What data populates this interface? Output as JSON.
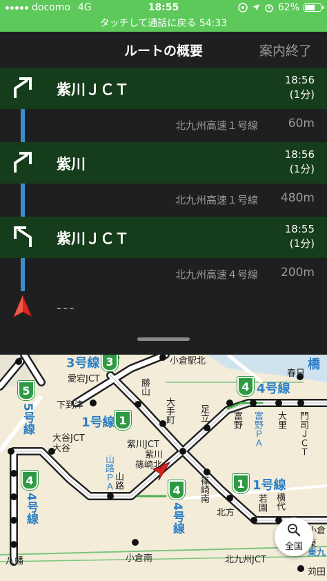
{
  "status_bar": {
    "carrier": "docomo",
    "network": "4G",
    "time": "18:55",
    "battery": "62%",
    "battery_level": 0.62
  },
  "call_banner": {
    "text": "タッチして通話に戻る 54:33"
  },
  "header": {
    "title": "ルートの概要",
    "end_button": "案内終了"
  },
  "steps": [
    {
      "kind": "turn",
      "icon": "turn-right-icon",
      "name": "紫川ＪＣＴ",
      "time": "18:56",
      "duration": "(1分)"
    },
    {
      "kind": "segment",
      "road": "北九州高速１号線",
      "distance": "60m"
    },
    {
      "kind": "turn",
      "icon": "turn-right-icon",
      "name": "紫川",
      "time": "18:56",
      "duration": "(1分)"
    },
    {
      "kind": "segment",
      "road": "北九州高速１号線",
      "distance": "480m"
    },
    {
      "kind": "turn",
      "icon": "turn-left-icon",
      "name": "紫川ＪＣＴ",
      "time": "18:55",
      "duration": "(1分)"
    },
    {
      "kind": "segment",
      "road": "北九州高速４号線",
      "distance": "200m"
    }
  ],
  "destination": {
    "icon": "current-position-arrow-icon",
    "label": "---"
  },
  "map": {
    "labels": {
      "route3": "3号線",
      "num3": "3",
      "kokura_eki_kita": "小倉駅北",
      "route_bashi": "橋",
      "atago_jct": "愛宕JCT",
      "katsuyama": "勝山",
      "kasuga": "春日",
      "num5": "5",
      "route5": "5号線",
      "shimoitozu": "下到津",
      "route1": "1号線",
      "num1": "1",
      "ohtemachi": "大手町",
      "ashidachi": "足立",
      "num4a": "4",
      "route4a": "4号線",
      "tomino": "富野",
      "tomino_pa": "富野ＰＡ",
      "ozato": "大里",
      "monji_jct": "門司ＪＣＴ",
      "otani_jct": "大谷JCT",
      "otani": "大谷",
      "murasaki_jct": "紫川JCT",
      "murasaki": "紫川",
      "shinozaki_kita": "篠崎北",
      "yamaji_pa": "山路ＰＡ",
      "yamaji": "山路",
      "num4b": "4",
      "route4b": "4号線",
      "num4c": "4",
      "route4c": "4号線",
      "shinozaki_minami": "篠崎南",
      "num1b": "1",
      "route1b": "1号線",
      "kitakata": "北方",
      "wakazono": "若園",
      "yokoshiro": "横代",
      "yahata": "八幡",
      "kokura_minami": "小倉南",
      "kitakyushu_jct": "北九州JCT",
      "kariya": "苅田",
      "kokura_higashi": "小倉東",
      "higashi_kyu": "東九"
    },
    "zoom_button": "全国"
  },
  "colors": {
    "status_green": "#5dc95a",
    "turn_row_bg": "#163d1b",
    "panel_bg": "#1e1f20",
    "route_blue": "#3c8fc9",
    "shield_green": "#2f9a43",
    "marker_red": "#d8291d"
  }
}
